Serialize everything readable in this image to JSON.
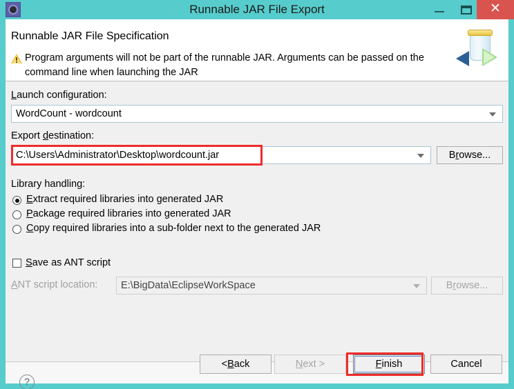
{
  "window": {
    "title": "Runnable JAR File Export",
    "app_icon": "eclipse-gear-icon",
    "controls": {
      "minimize": "—",
      "maximize": "maximize-icon",
      "close": "✕"
    },
    "colors": {
      "titlebar": "#57CCCC",
      "close_button": "#D9534F",
      "dialog_background": "#F0F0F0",
      "annotation": "#EE2B2B"
    }
  },
  "header": {
    "title": "Runnable JAR File Specification",
    "warning_icon": "warning-triangle-icon",
    "message": "Program arguments will not be part of the runnable JAR. Arguments can be passed on the command line when launching the JAR",
    "side_icon": "runnable-jar-icon"
  },
  "form": {
    "launch_configuration": {
      "label_prefix": "",
      "label_mnemonic": "L",
      "label_suffix": "aunch configuration:",
      "value": "WordCount - wordcount"
    },
    "export_destination": {
      "label_prefix": "Export ",
      "label_mnemonic": "d",
      "label_suffix": "estination:",
      "value": "C:\\Users\\Administrator\\Desktop\\wordcount.jar",
      "browse_prefix": "B",
      "browse_mnemonic": "r",
      "browse_suffix": "owse..."
    },
    "library_handling": {
      "label": "Library handling:",
      "options": [
        {
          "prefix": "",
          "mnemonic": "E",
          "suffix": "xtract required libraries into generated JAR",
          "selected": true
        },
        {
          "prefix": "",
          "mnemonic": "P",
          "suffix": "ackage required libraries into generated JAR",
          "selected": false
        },
        {
          "prefix": "",
          "mnemonic": "C",
          "suffix": "opy required libraries into a sub-folder next to the generated JAR",
          "selected": false
        }
      ]
    },
    "save_ant_script": {
      "prefix": "",
      "mnemonic": "S",
      "suffix": "ave as ANT script",
      "checked": false
    },
    "ant_script_location": {
      "label_prefix": "",
      "label_mnemonic": "A",
      "label_suffix": "NT script location:",
      "value": "E:\\BigData\\EclipseWorkSpace",
      "disabled": true,
      "browse_prefix": "B",
      "browse_mnemonic": "r",
      "browse_suffix": "owse..."
    }
  },
  "footer": {
    "help": "?",
    "buttons": {
      "back": {
        "prefix": "< ",
        "mnemonic": "B",
        "suffix": "ack",
        "disabled": false
      },
      "next": {
        "prefix": "",
        "mnemonic": "N",
        "suffix": "ext >",
        "disabled": true
      },
      "finish": {
        "prefix": "",
        "mnemonic": "F",
        "suffix": "inish",
        "disabled": false,
        "focused": true,
        "highlighted": true
      },
      "cancel": {
        "prefix": "Cancel",
        "mnemonic": "",
        "suffix": "",
        "disabled": false
      }
    }
  }
}
